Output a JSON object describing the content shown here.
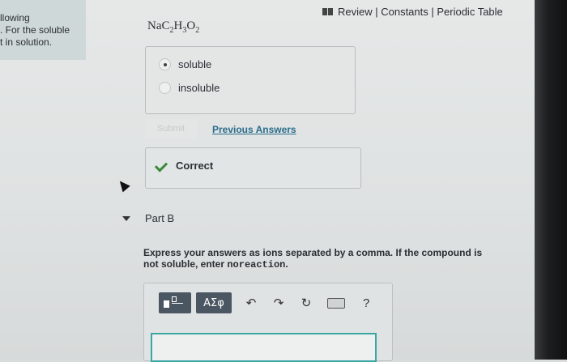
{
  "intro": {
    "text": "llowing\n. For the soluble\nt in solution."
  },
  "header": {
    "links_text": "Review | Constants | Periodic Table"
  },
  "part_a": {
    "formula": {
      "base": "NaC",
      "s1": "2",
      "mid1": "H",
      "s2": "3",
      "mid2": "O",
      "s3": "2"
    },
    "options": [
      {
        "label": "soluble",
        "selected": true
      },
      {
        "label": "insoluble",
        "selected": false
      }
    ],
    "submit_label": "Submit",
    "previous_answers_label": "Previous Answers",
    "feedback": "Correct"
  },
  "part_b": {
    "title": "Part B",
    "instructions_prefix": "Express your answers as ions separated by a comma. If the compound is not soluble, enter ",
    "instructions_code": "noreaction",
    "instructions_suffix": ".",
    "greek_label": "ΑΣφ",
    "undo_icon": "↶",
    "redo_icon": "↷",
    "reset_icon": "↻",
    "help_label": "?",
    "answer_value": ""
  },
  "colors": {
    "link": "#2a6c8a",
    "correct": "#3a8a3a",
    "input_border": "#3aa7a3",
    "toolbar_btn": "#4a5662"
  }
}
